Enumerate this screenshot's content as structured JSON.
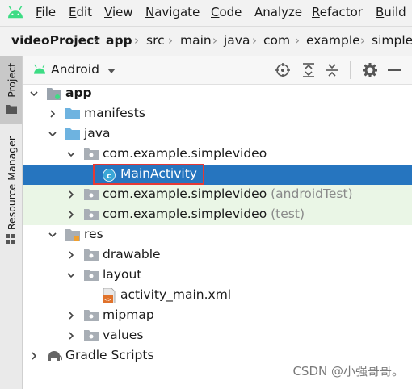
{
  "menu": {
    "items": [
      {
        "first": "F",
        "rest": "ile"
      },
      {
        "first": "E",
        "rest": "dit"
      },
      {
        "first": "V",
        "rest": "iew"
      },
      {
        "first": "N",
        "rest": "avigate"
      },
      {
        "first": "C",
        "rest": "ode"
      },
      {
        "first": "",
        "rest": "Analyze"
      },
      {
        "first": "R",
        "rest": "efactor"
      },
      {
        "first": "B",
        "rest": "uild"
      }
    ]
  },
  "breadcrumb": [
    "videoProject",
    "app",
    "src",
    "main",
    "java",
    "com",
    "example",
    "simplev"
  ],
  "toolstrip": {
    "project_label": "Project",
    "resource_manager_label": "Resource Manager"
  },
  "panel": {
    "view_selector": "Android",
    "icons": [
      "locate-icon",
      "expand-all-icon",
      "collapse-all-icon",
      "settings-gear-icon",
      "hide-minus-icon"
    ]
  },
  "tree": [
    {
      "label": "app",
      "suffix": ""
    },
    {
      "label": "manifests",
      "suffix": ""
    },
    {
      "label": "java",
      "suffix": ""
    },
    {
      "label": "com.example.simplevideo",
      "suffix": ""
    },
    {
      "label": "MainActivity",
      "suffix": ""
    },
    {
      "label": "com.example.simplevideo",
      "suffix": "(androidTest)"
    },
    {
      "label": "com.example.simplevideo",
      "suffix": "(test)"
    },
    {
      "label": "res",
      "suffix": ""
    },
    {
      "label": "drawable",
      "suffix": ""
    },
    {
      "label": "layout",
      "suffix": ""
    },
    {
      "label": "activity_main.xml",
      "suffix": ""
    },
    {
      "label": "mipmap",
      "suffix": ""
    },
    {
      "label": "values",
      "suffix": ""
    },
    {
      "label": "Gradle Scripts",
      "suffix": ""
    }
  ],
  "watermark": "CSDN @小强哥哥。",
  "colors": {
    "selection": "#2675bf",
    "test_row_bg": "#eaf6e6",
    "folder_blue": "#6eb3e0",
    "android_green": "#3ddc84",
    "highlight_border": "#e53935"
  }
}
